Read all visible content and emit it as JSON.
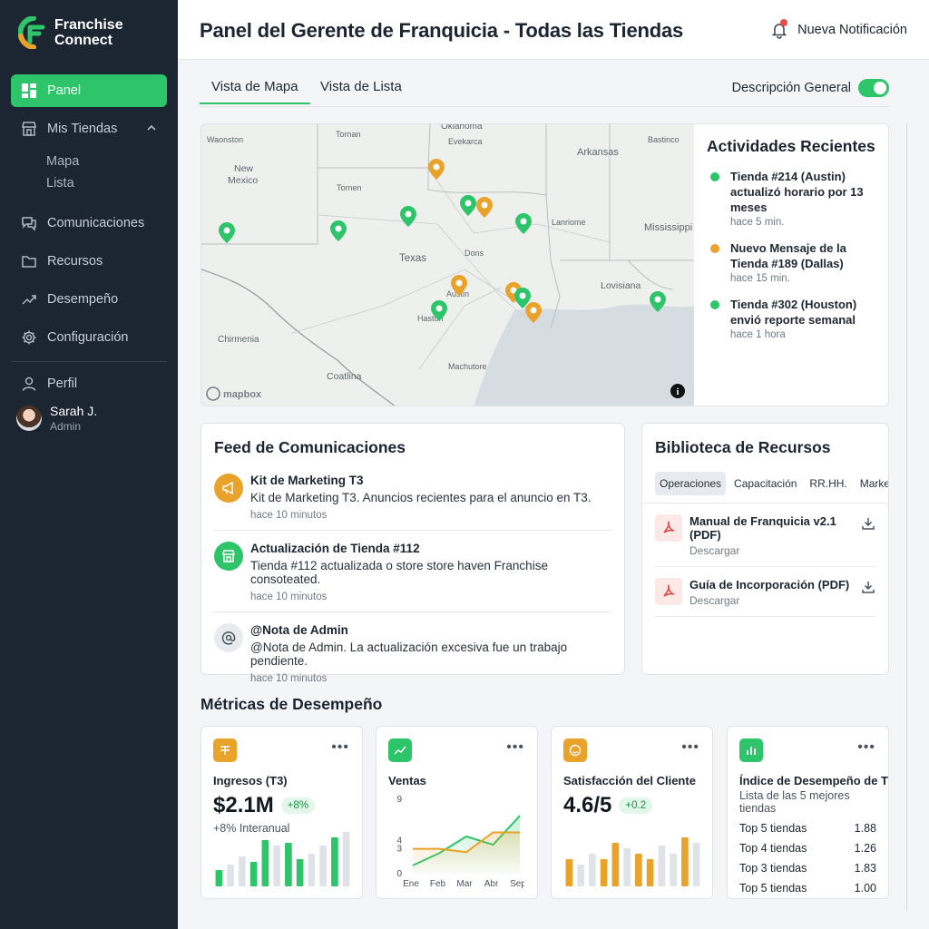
{
  "brand": {
    "line1": "Franchise",
    "line2": "Connect",
    "green": "#2ec46a",
    "orange": "#e9a22a"
  },
  "sidebar": {
    "items": [
      {
        "label": "Panel",
        "icon": "dashboard-icon"
      },
      {
        "label": "Mis Tiendas",
        "icon": "store-icon"
      },
      {
        "label": "Comunicaciones",
        "icon": "chat-icon"
      },
      {
        "label": "Recursos",
        "icon": "folder-icon"
      },
      {
        "label": "Desempeño",
        "icon": "trend-icon"
      },
      {
        "label": "Configuración",
        "icon": "gear-icon"
      },
      {
        "label": "Perfil",
        "icon": "user-icon"
      }
    ],
    "subitems": [
      "Mapa",
      "Lista"
    ],
    "user": {
      "name": "Sarah J.",
      "role": "Admin"
    }
  },
  "header": {
    "title": "Panel del Gerente de Franquicia - Todas las Tiendas",
    "notification": "Nueva Notificación"
  },
  "tabs": {
    "map": "Vista de Mapa",
    "list": "Vista de Lista",
    "toggle_label": "Descripción General"
  },
  "map": {
    "labels": [
      "Oklahoma",
      "Evekarca",
      "Waonston",
      "Tornan",
      "Arkansas",
      "Bastinco",
      "New",
      "Mexico",
      "Tornen",
      "Lanriome",
      "Mississippi",
      "Texas",
      "Dons",
      "Lovisiana",
      "Haston",
      "Austin",
      "Chirmenia",
      "Coatlina",
      "Machutore",
      "mapbox"
    ],
    "info_icon": "info-icon"
  },
  "activity": {
    "title": "Actividades Recientes",
    "items": [
      {
        "text": "Tienda #214 (Austin) actualizó horario por 13 meses",
        "time": "hace 5 min.",
        "color": "#2ec46a"
      },
      {
        "text": "Nuevo Mensaje de la Tienda #189 (Dallas)",
        "time": "hace 15 min.",
        "color": "#e9a22a"
      },
      {
        "text": "Tienda #302 (Houston) envió reporte semanal",
        "time": "hace 1 hora",
        "color": "#2ec46a"
      }
    ]
  },
  "comms": {
    "title": "Feed de Comunicaciones",
    "items": [
      {
        "title": "Kit de Marketing T3",
        "body": "Kit de Marketing T3. Anuncios recientes para el anuncio en T3.",
        "time": "hace 10 minutos"
      },
      {
        "title": "Actualización de Tienda #112",
        "body": "Tienda #112 actualizada o store store haven Franchise consoteated.",
        "time": "hace 10 minutos"
      },
      {
        "title": "@Nota de Admin",
        "body": "@Nota de Admin. La actualización excesiva fue un trabajo pendiente.",
        "time": "hace 10 minutos"
      }
    ]
  },
  "resources": {
    "title": "Biblioteca de Recursos",
    "chips": [
      "Operaciones",
      "Capacitación",
      "RR.HH.",
      "Marketing"
    ],
    "items": [
      {
        "title": "Manual de Franquicia v2.1 (PDF)",
        "sub": "Descargar"
      },
      {
        "title": "Guía de Incorporación (PDF)",
        "sub": "Descargar"
      }
    ]
  },
  "metrics": {
    "title": "Métricas de Desempeño",
    "revenue": {
      "label": "Ingresos (T3)",
      "value": "$2.1M",
      "badge": "+8%",
      "sub": "+8% Interanual"
    },
    "sales": {
      "label": "Ventas"
    },
    "satisfaction": {
      "label": "Satisfacción del Cliente",
      "value": "4.6/5",
      "badge": "+0.2"
    },
    "index": {
      "label": "Índice de Desempeño de Tienda",
      "sub": "Lista de las 5 mejores tiendas",
      "rows": [
        {
          "name": "Top 5 tiendas",
          "value": "1.88"
        },
        {
          "name": "Top 4 tiendas",
          "value": "1.26"
        },
        {
          "name": "Top 3 tiendas",
          "value": "1.83"
        },
        {
          "name": "Top 5 tiendas",
          "value": "1.00"
        }
      ]
    }
  },
  "chart_data": [
    {
      "type": "bar",
      "categories": [
        "1",
        "2",
        "3",
        "4",
        "5",
        "6",
        "7",
        "8",
        "9",
        "10",
        "11",
        "12"
      ],
      "series": [
        {
          "values": [
            3,
            4,
            5.5,
            4.5,
            8.5,
            7.5,
            8,
            5,
            6,
            7.5,
            9,
            10
          ]
        }
      ],
      "ylim": [
        0,
        10
      ]
    },
    {
      "type": "area",
      "categories": [
        "Ene",
        "Feb",
        "Mar",
        "Abr",
        "Sep"
      ],
      "yticks": [
        0,
        3,
        4,
        9
      ],
      "series": [
        {
          "values": [
            1,
            2.5,
            4.5,
            3.5,
            7
          ]
        },
        {
          "values": [
            3,
            3,
            2.6,
            5,
            5
          ]
        }
      ],
      "ylim": [
        0,
        9
      ]
    },
    {
      "type": "bar",
      "categories": [
        "1",
        "2",
        "3",
        "4",
        "5",
        "6",
        "7",
        "8",
        "9",
        "10",
        "11",
        "12"
      ],
      "series": [
        {
          "values": [
            5,
            4,
            6,
            5,
            8,
            7,
            6,
            5,
            7.5,
            6,
            9,
            8
          ]
        }
      ],
      "ylim": [
        0,
        10
      ]
    }
  ]
}
